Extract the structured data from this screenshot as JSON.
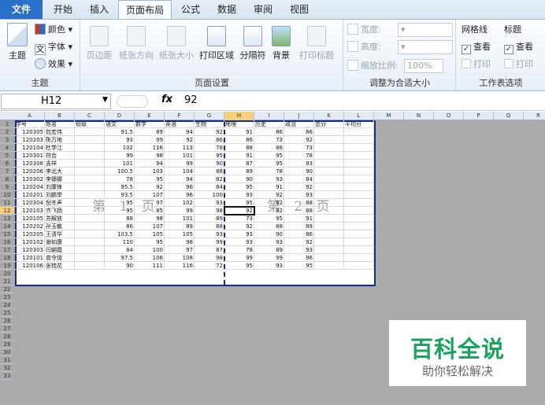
{
  "tabs": [
    "文件",
    "开始",
    "插入",
    "页面布局",
    "公式",
    "数据",
    "审阅",
    "视图"
  ],
  "ribbon": {
    "theme_group": {
      "title": "主题",
      "theme_label": "主题",
      "colors": "颜色",
      "fonts": "字体",
      "effects": "效果"
    },
    "page_setup_group": {
      "title": "页面设置",
      "buttons": [
        "页边距",
        "纸张方向",
        "纸张大小",
        "打印区域",
        "分隔符",
        "背景",
        "打印标题"
      ]
    },
    "scale_group": {
      "title": "调整为合适大小",
      "width_label": "宽度:",
      "height_label": "高度:",
      "scale_label": "缩放比例:",
      "scale_value": "100%"
    },
    "sheet_options_group": {
      "title": "工作表选项",
      "gridlines": "网格线",
      "headings": "标题",
      "view": "查看",
      "print": "打印",
      "gridlines_view_checked": true,
      "headings_view_checked": true
    }
  },
  "formula_bar": {
    "name_box": "H12",
    "fx": "fx",
    "value": "92"
  },
  "columns": [
    "A",
    "B",
    "C",
    "D",
    "E",
    "F",
    "G",
    "H",
    "I",
    "J",
    "K",
    "L",
    "M",
    "N",
    "O",
    "P",
    "Q",
    "R"
  ],
  "selected_column": "H",
  "selected_row": 12,
  "row_numbers": [
    1,
    2,
    3,
    4,
    5,
    6,
    7,
    8,
    9,
    10,
    11,
    12,
    13,
    14,
    15,
    16,
    17,
    18,
    19,
    20,
    21,
    22,
    23,
    24,
    25,
    26,
    27,
    28,
    29,
    30,
    31,
    32,
    33
  ],
  "table": {
    "headers": [
      "学号",
      "姓名",
      "班级",
      "语文",
      "数学",
      "英语",
      "生物",
      "地理",
      "历史",
      "政治",
      "总分",
      "平均分"
    ],
    "rows": [
      [
        "120305",
        "包宏伟",
        "",
        "91.5",
        "89",
        "94",
        "92",
        "91",
        "86",
        "86",
        "",
        ""
      ],
      [
        "120203",
        "陈万地",
        "",
        "93",
        "99",
        "92",
        "86",
        "86",
        "73",
        "92",
        "",
        ""
      ],
      [
        "120104",
        "杜学江",
        "",
        "102",
        "116",
        "113",
        "78",
        "88",
        "86",
        "73",
        "",
        ""
      ],
      [
        "120301",
        "符合",
        "",
        "99",
        "98",
        "101",
        "95",
        "91",
        "95",
        "78",
        "",
        ""
      ],
      [
        "120306",
        "吉祥",
        "",
        "101",
        "94",
        "99",
        "90",
        "87",
        "95",
        "93",
        "",
        ""
      ],
      [
        "120206",
        "李北大",
        "",
        "100.5",
        "103",
        "104",
        "88",
        "89",
        "78",
        "90",
        "",
        ""
      ],
      [
        "120302",
        "李娜娜",
        "",
        "78",
        "95",
        "94",
        "82",
        "90",
        "93",
        "84",
        "",
        ""
      ],
      [
        "120204",
        "刘康锋",
        "",
        "95.5",
        "92",
        "96",
        "84",
        "95",
        "91",
        "92",
        "",
        ""
      ],
      [
        "120201",
        "刘鹏举",
        "",
        "93.5",
        "107",
        "96",
        "100",
        "93",
        "92",
        "93",
        "",
        ""
      ],
      [
        "120304",
        "倪冬声",
        "",
        "95",
        "97",
        "102",
        "93",
        "95",
        "92",
        "88",
        "",
        ""
      ],
      [
        "120103",
        "齐飞扬",
        "",
        "95",
        "85",
        "99",
        "98",
        "92",
        "92",
        "88",
        "",
        ""
      ],
      [
        "120105",
        "苏解放",
        "",
        "88",
        "98",
        "101",
        "89",
        "73",
        "95",
        "91",
        "",
        ""
      ],
      [
        "120202",
        "孙玉敏",
        "",
        "86",
        "107",
        "89",
        "88",
        "92",
        "88",
        "89",
        "",
        ""
      ],
      [
        "120205",
        "王清华",
        "",
        "103.5",
        "105",
        "105",
        "93",
        "93",
        "90",
        "86",
        "",
        ""
      ],
      [
        "120102",
        "谢如康",
        "",
        "110",
        "95",
        "98",
        "99",
        "93",
        "93",
        "92",
        "",
        ""
      ],
      [
        "120303",
        "闫朝霞",
        "",
        "84",
        "100",
        "97",
        "87",
        "78",
        "89",
        "93",
        "",
        ""
      ],
      [
        "120101",
        "曾令煊",
        "",
        "97.5",
        "106",
        "108",
        "98",
        "99",
        "99",
        "96",
        "",
        ""
      ],
      [
        "120106",
        "张桂花",
        "",
        "90",
        "111",
        "116",
        "72",
        "95",
        "93",
        "95",
        "",
        ""
      ]
    ]
  },
  "watermarks": {
    "page1": "第 1 页",
    "page2": "第 2 页"
  },
  "logo": {
    "title": "百科全说",
    "subtitle": "助你轻松解决"
  }
}
